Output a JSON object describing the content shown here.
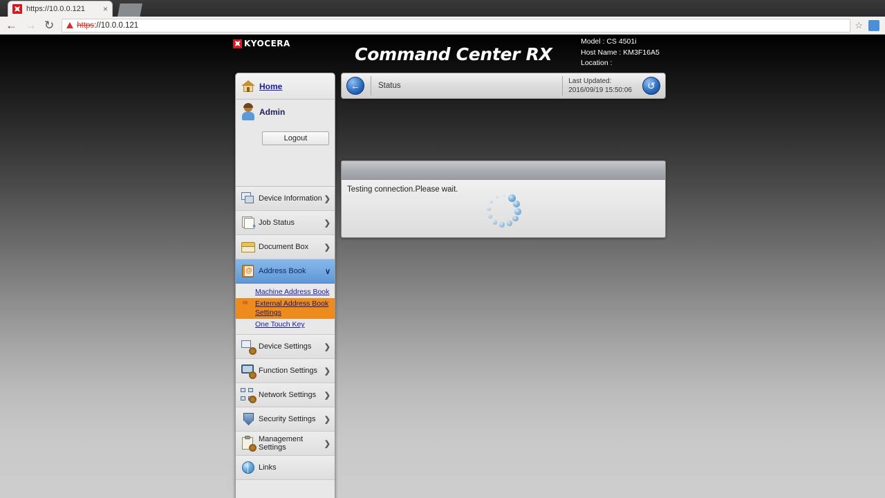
{
  "browser": {
    "tab_title": "https://10.0.0.121",
    "tab_close": "×",
    "back_icon": "←",
    "forward_icon": "→",
    "reload_icon": "↻",
    "url_scheme": "https",
    "url_rest": "://10.0.0.121",
    "star_icon": "☆"
  },
  "header": {
    "brand": "KYOCERA",
    "title_main": "Command Center R",
    "title_rx": "X",
    "model_label": "Model : CS 4501i",
    "hostname_label": "Host Name : KM3F16A5",
    "location_label": "Location :"
  },
  "sidebar": {
    "home_label": "Home",
    "user_name": "Admin",
    "logout_label": "Logout",
    "items": [
      {
        "label": "Device Information",
        "icon": "device-information-icon",
        "chevron": "❯",
        "active": false
      },
      {
        "label": "Job Status",
        "icon": "job-status-icon",
        "chevron": "❯",
        "active": false
      },
      {
        "label": "Document Box",
        "icon": "document-box-icon",
        "chevron": "❯",
        "active": false
      },
      {
        "label": "Address Book",
        "icon": "address-book-icon",
        "chevron": "∨",
        "active": true
      },
      {
        "label": "Device Settings",
        "icon": "device-settings-icon",
        "chevron": "❯",
        "active": false
      },
      {
        "label": "Function Settings",
        "icon": "function-settings-icon",
        "chevron": "❯",
        "active": false
      },
      {
        "label": "Network Settings",
        "icon": "network-settings-icon",
        "chevron": "❯",
        "active": false
      },
      {
        "label": "Security Settings",
        "icon": "security-settings-icon",
        "chevron": "❯",
        "active": false
      },
      {
        "label": "Management Settings",
        "icon": "management-settings-icon",
        "chevron": "❯",
        "active": false
      },
      {
        "label": "Links",
        "icon": "links-icon",
        "chevron": "",
        "active": false
      }
    ],
    "subitems": [
      {
        "label": "Machine Address Book",
        "highlighted": false
      },
      {
        "label": "External Address Book Settings",
        "highlighted": true
      },
      {
        "label": "One Touch Key",
        "highlighted": false
      }
    ]
  },
  "status_bar": {
    "back_icon": "←",
    "status_label": "Status",
    "last_updated_label": "Last Updated:",
    "last_updated_value": "2016/09/19 15:50:06",
    "refresh_icon": "↺"
  },
  "content": {
    "message": "Testing connection.Please wait."
  },
  "colors": {
    "accent_blue": "#5f97d6",
    "highlight_orange": "#ed8b1c",
    "brand_red": "#d31a23",
    "link_blue": "#1a1aa8"
  }
}
